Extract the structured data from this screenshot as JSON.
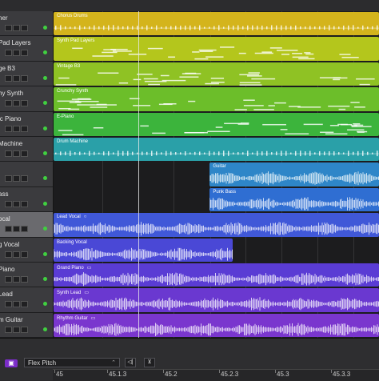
{
  "tracks": [
    {
      "name": "ner",
      "led": true,
      "buttons": [
        "",
        "",
        ""
      ],
      "region": {
        "name": "Chorus Drums",
        "color": "#d4b41c",
        "start": 0.0,
        "end": 1.0,
        "kind": "drum"
      }
    },
    {
      "name": "Pad Layers",
      "led": true,
      "buttons": [
        "",
        "",
        ""
      ],
      "region": {
        "name": "Synth Pad Layers",
        "color": "#b4c61c",
        "start": 0.0,
        "end": 1.0,
        "kind": "midi"
      }
    },
    {
      "name": "ge B3",
      "led": true,
      "buttons": [
        "",
        "",
        ""
      ],
      "region": {
        "name": "Vintage B3",
        "color": "#8fc224",
        "start": 0.0,
        "end": 1.0,
        "kind": "midi"
      }
    },
    {
      "name": "hy Synth",
      "led": true,
      "buttons": [
        "",
        "",
        ""
      ],
      "region": {
        "name": "Crunchy Synth",
        "color": "#6cbe2a",
        "start": 0.0,
        "end": 1.0,
        "kind": "midi"
      }
    },
    {
      "name": "ic Piano",
      "led": true,
      "buttons": [
        "",
        "",
        ""
      ],
      "region": {
        "name": "E-Piano",
        "color": "#3cb43c",
        "start": 0.0,
        "end": 1.0,
        "kind": "midi"
      }
    },
    {
      "name": "Machine",
      "led": true,
      "buttons": [
        "",
        "",
        ""
      ],
      "region": {
        "name": "Drum Machine",
        "color": "#2aa0a8",
        "start": 0.0,
        "end": 1.0,
        "kind": "drum"
      }
    },
    {
      "name": "",
      "led": true,
      "buttons": [
        "",
        "",
        ""
      ],
      "region": {
        "name": "Guitar",
        "color": "#2e86c8",
        "start": 0.48,
        "end": 1.0,
        "kind": "audio"
      }
    },
    {
      "name": "ass",
      "led": true,
      "buttons": [
        "",
        "",
        ""
      ],
      "region": {
        "name": "Punk Bass",
        "color": "#2f6ed2",
        "start": 0.48,
        "end": 1.0,
        "kind": "audio"
      }
    },
    {
      "name": "ocal",
      "led": true,
      "buttons": [
        "",
        "",
        ""
      ],
      "selected": true,
      "region": {
        "name": "Lead Vocal",
        "color": "#4058d8",
        "start": 0.0,
        "end": 1.0,
        "kind": "audio",
        "icon": "○"
      }
    },
    {
      "name": "g Vocal",
      "led": true,
      "buttons": [
        "",
        "",
        ""
      ],
      "region": {
        "name": "Backing Vocal",
        "color": "#4a48d6",
        "start": 0.0,
        "end": 0.55,
        "kind": "audio"
      }
    },
    {
      "name": "Piano",
      "led": true,
      "buttons": [
        "",
        "",
        ""
      ],
      "region": {
        "name": "Grand Piano",
        "color": "#5a3cd4",
        "start": 0.0,
        "end": 1.0,
        "kind": "audio",
        "icon": "▭"
      }
    },
    {
      "name": "Lead",
      "led": true,
      "buttons": [
        "",
        "",
        ""
      ],
      "region": {
        "name": "Synth Lead",
        "color": "#6a38d0",
        "start": 0.0,
        "end": 1.0,
        "kind": "audio",
        "icon": "▭"
      }
    },
    {
      "name": "m Guitar",
      "led": true,
      "buttons": [
        "",
        "",
        ""
      ],
      "region": {
        "name": "Rhythm Guitar",
        "color": "#7a36ce",
        "start": 0.0,
        "end": 1.0,
        "kind": "audio",
        "icon": "▭"
      }
    }
  ],
  "editor": {
    "mode": "Flex Pitch",
    "pitch_icon": "pitch-icon",
    "ruler": [
      "45",
      "45.1.3",
      "45.2",
      "45.2.3",
      "45.3",
      "45.3.3"
    ]
  },
  "colors": {
    "accent": "#7b2cc8",
    "playhead": "#e8e8e8"
  }
}
